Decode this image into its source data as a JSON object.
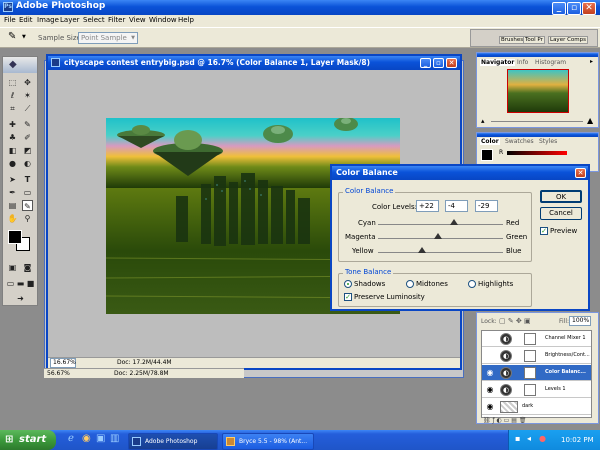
{
  "app": {
    "title": "Adobe Photoshop"
  },
  "menu": [
    "File",
    "Edit",
    "Image",
    "Layer",
    "Select",
    "Filter",
    "View",
    "Window",
    "Help"
  ],
  "options": {
    "sample_size_label": "Sample Size:",
    "sample_size_value": "Point Sample"
  },
  "palette_well": [
    "Brushes",
    "Tool Pr",
    "Layer Comps"
  ],
  "document": {
    "title": "cityscape contest entrybig.psd @ 16.7% (Color Balance 1, Layer Mask/8)",
    "zoom": "16.67%",
    "doc_info": "Doc: 17.2M/44.4M",
    "zoom2": "56.67%",
    "doc_info2": "Doc: 2.25M/78.8M"
  },
  "navigator": {
    "tabs": [
      "Navigator",
      "Info",
      "Histogram"
    ]
  },
  "color_panel": {
    "tabs": [
      "Color",
      "Swatches",
      "Styles"
    ],
    "channel": "R"
  },
  "layers": {
    "lock_label": "Lock:",
    "fill_label": "Fill:",
    "fill_value": "100%",
    "items": [
      {
        "name": "Channel Mixer 1",
        "selected": false,
        "visible": false
      },
      {
        "name": "Brightness/Cont...",
        "selected": false,
        "visible": false
      },
      {
        "name": "Color Balanc...",
        "selected": true,
        "visible": true
      },
      {
        "name": "Levels 1",
        "selected": false,
        "visible": true
      },
      {
        "name": "dark",
        "selected": false,
        "visible": true
      }
    ]
  },
  "dialog": {
    "title": "Color Balance",
    "color_balance_group": "Color Balance",
    "color_levels_label": "Color Levels:",
    "levels": [
      "+22",
      "-4",
      "-29"
    ],
    "sliders": [
      {
        "left": "Cyan",
        "right": "Red",
        "value": 22
      },
      {
        "left": "Magenta",
        "right": "Green",
        "value": -4
      },
      {
        "left": "Yellow",
        "right": "Blue",
        "value": -29
      }
    ],
    "tone_group": "Tone Balance",
    "tones": [
      "Shadows",
      "Midtones",
      "Highlights"
    ],
    "selected_tone": "Shadows",
    "preserve_label": "Preserve Luminosity",
    "preserve_checked": true,
    "ok": "OK",
    "cancel": "Cancel",
    "preview_label": "Preview",
    "preview_checked": true
  },
  "taskbar": {
    "start": "start",
    "items": [
      "Adobe Photoshop",
      "Bryce 5.5 - 98% (Ant..."
    ],
    "clock": "10:02 PM"
  },
  "colors": {
    "title_blue": "#0a52d8",
    "taskbar_blue": "#245edb",
    "start_green": "#3c9a3c",
    "dialog_bg": "#ece9d8"
  }
}
